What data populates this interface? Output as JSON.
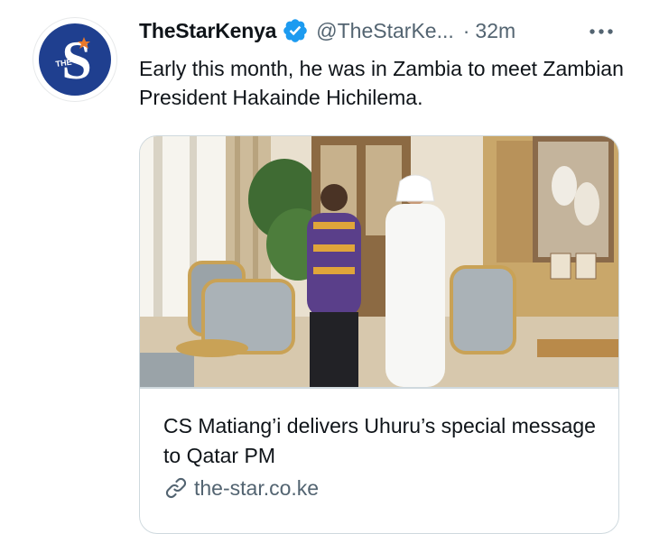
{
  "tweet": {
    "display_name": "TheStarKenya",
    "handle": "@TheStarKe...",
    "separator": "·",
    "time": "32m",
    "text": "Early this month, he was in Zambia to meet Zambian President Hakainde Hichilema.",
    "verified": true
  },
  "avatar": {
    "logo_letter": "S",
    "logo_small_text": "THE",
    "brand_color": "#1f3f8f",
    "accent_color": "#e8782a"
  },
  "card": {
    "title": "CS Matiang’i delivers Uhuru’s special message to Qatar PM",
    "domain": "the-star.co.ke"
  },
  "colors": {
    "verified_blue": "#1d9bf0",
    "muted_text": "#536471",
    "border": "#cfd9de"
  },
  "icons": [
    "verified-badge-icon",
    "more-options-icon",
    "link-icon"
  ]
}
